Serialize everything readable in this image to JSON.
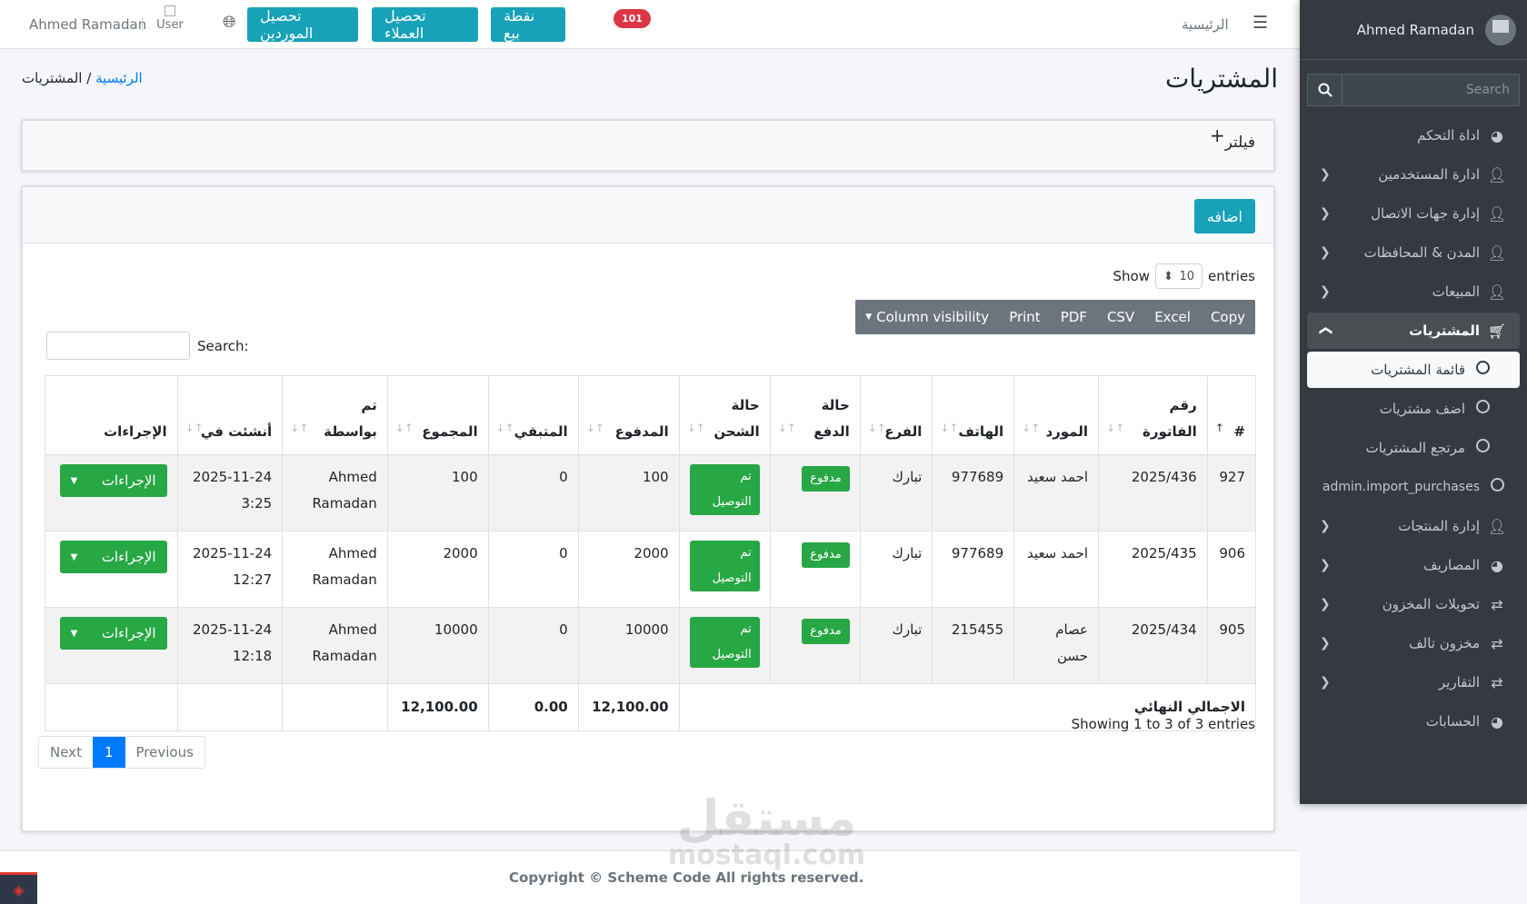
{
  "topnav": {
    "user_name": "Ahmed Ramadan",
    "user_img_alt": "User",
    "btn_pos": "نقطة بيع",
    "btn_customers": "تحصيل العملاء",
    "btn_suppliers": "تحصيل الموردين",
    "notifications_count": "101",
    "home_link": "الرئيسية"
  },
  "sidebar": {
    "user_name": "Ahmed Ramadan",
    "search_placeholder": "Search",
    "items": [
      {
        "label": "اداة التحكم"
      },
      {
        "label": "ادارة المستخدمين"
      },
      {
        "label": "إدارة جهات الاتصال"
      },
      {
        "label": "المدن & المحافظات"
      },
      {
        "label": "المبيعات"
      },
      {
        "label": "المشتريات"
      },
      {
        "label": "قائمة المشتريات"
      },
      {
        "label": "اضف مشتريات"
      },
      {
        "label": "مرتجع المشتريات"
      },
      {
        "label": "admin.import_purchases"
      },
      {
        "label": "إدارة المنتجات"
      },
      {
        "label": "المصاريف"
      },
      {
        "label": "تحويلات المخزون"
      },
      {
        "label": "مخزون تالف"
      },
      {
        "label": "التقارير"
      },
      {
        "label": "الحسابات"
      }
    ]
  },
  "page": {
    "title": "المشتريات",
    "breadcrumb_home": "الرئيسية",
    "breadcrumb_sep": " / ",
    "breadcrumb_current": "المشتريات",
    "filter_label": "فيلتر",
    "filter_plus": "+",
    "add_button": "اضافه"
  },
  "datatable": {
    "show_label": "Show",
    "entries_label": "entries",
    "page_length": "10",
    "buttons": [
      "Copy",
      "Excel",
      "CSV",
      "PDF",
      "Print",
      "Column visibility"
    ],
    "search_label": "Search:",
    "columns": [
      "#",
      "رقم الفاتورة",
      "المورد",
      "الهاتف",
      "الفرع",
      "حالة الدفع",
      "حالة الشحن",
      "المدفوع",
      "المتبقي",
      "المجموع",
      "تم بواسطة",
      "أنشئت في",
      "الإجراءات"
    ],
    "rows": [
      {
        "id": "927",
        "invoice": "2025/436",
        "supplier": "احمد سعيد",
        "phone": "977689",
        "branch": "تبارك",
        "payment_status": "مدفوع",
        "shipping_status": "تم التوصيل",
        "paid": "100",
        "remaining": "0",
        "total": "100",
        "created_by": "Ahmed Ramadan",
        "created_at": "2025-11-24 3:25",
        "actions": "الإجراءات"
      },
      {
        "id": "906",
        "invoice": "2025/435",
        "supplier": "احمد سعيد",
        "phone": "977689",
        "branch": "تبارك",
        "payment_status": "مدفوع",
        "shipping_status": "تم التوصيل",
        "paid": "2000",
        "remaining": "0",
        "total": "2000",
        "created_by": "Ahmed Ramadan",
        "created_at": "2025-11-24 12:27",
        "actions": "الإجراءات"
      },
      {
        "id": "905",
        "invoice": "2025/434",
        "supplier": "عصام حسن",
        "phone": "215455",
        "branch": "تبارك",
        "payment_status": "مدفوع",
        "shipping_status": "تم التوصيل",
        "paid": "10000",
        "remaining": "0",
        "total": "10000",
        "created_by": "Ahmed Ramadan",
        "created_at": "2025-11-24 12:18",
        "actions": "الإجراءات"
      }
    ],
    "footer": {
      "label": "الاجمالي النهائي",
      "paid": "12,100.00",
      "remaining": "0.00",
      "total": "12,100.00"
    },
    "info": "Showing 1 to 3 of 3 entries",
    "pagination": {
      "previous": "Previous",
      "current": "1",
      "next": "Next"
    }
  },
  "footer": {
    "copyright": "Copyright © Scheme Code All rights reserved."
  },
  "watermark": {
    "line1": "مستقل",
    "line2": "mostaql.com"
  },
  "colors": {
    "accent": "#17a2b8",
    "success": "#28a745",
    "danger": "#dc3545",
    "primary": "#007bff",
    "sidebar_bg": "#343a40"
  }
}
